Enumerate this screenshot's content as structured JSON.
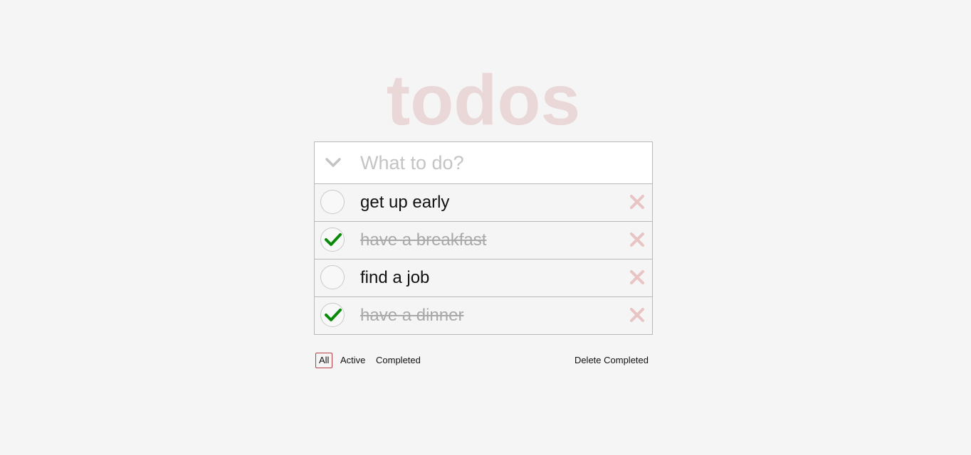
{
  "app": {
    "title": "todos"
  },
  "new_todo": {
    "placeholder": "What to do?",
    "value": ""
  },
  "todos": [
    {
      "label": "get up early",
      "completed": false
    },
    {
      "label": "have a breakfast",
      "completed": true
    },
    {
      "label": "find a job",
      "completed": false
    },
    {
      "label": "have a dinner",
      "completed": true
    }
  ],
  "footer": {
    "filters": [
      "All",
      "Active",
      "Completed"
    ],
    "selected_filter": "All",
    "clear_label": "Delete Completed"
  },
  "colors": {
    "background": "#f5f5f5",
    "title": "#ead7d7",
    "check_mark": "#0a8a0a",
    "destroy": "#e8c4c4",
    "selected_filter_border": "#b83f45"
  },
  "icons": {
    "toggle_all": "chevron-down-icon",
    "completed": "check-icon",
    "destroy": "close-icon"
  }
}
